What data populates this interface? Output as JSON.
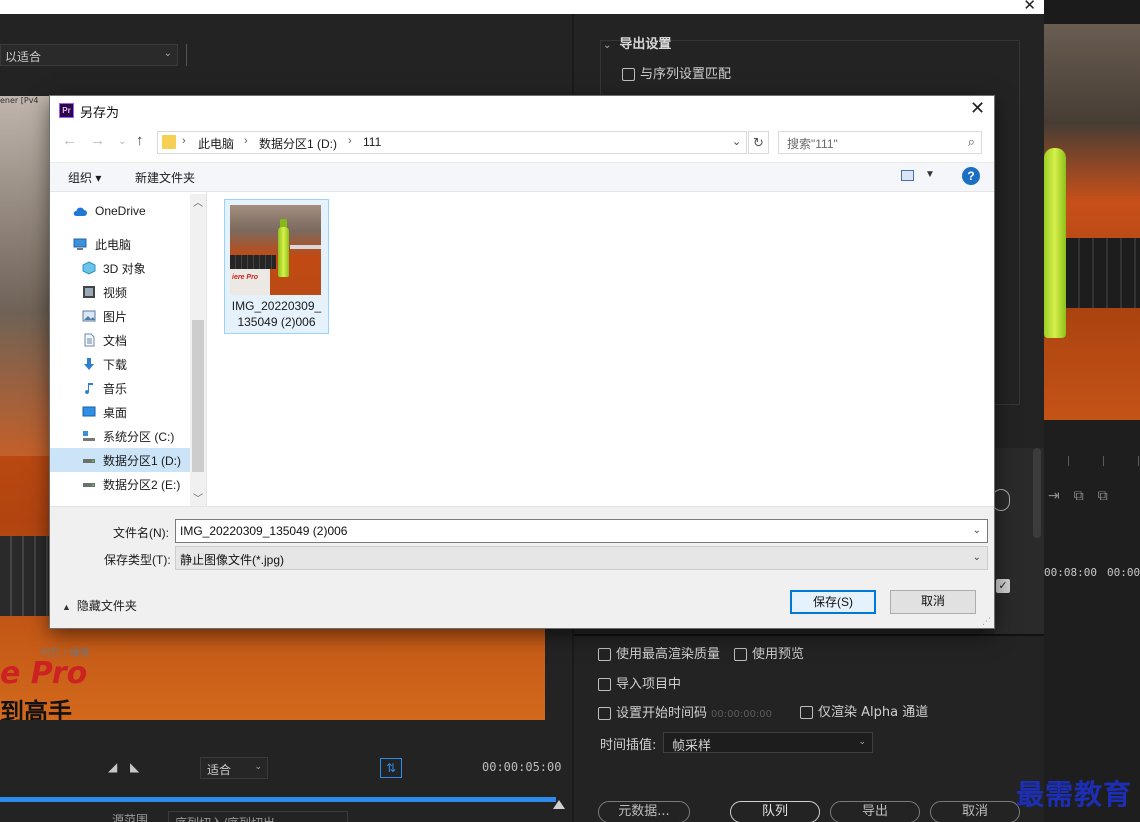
{
  "premiere": {
    "top_dropdown": "以适合",
    "preview_snippet": "ener [Pv4",
    "book_title": "e Pro",
    "book_author": "刘艺 / 编著",
    "book_subtitle": "到高手",
    "fit_dropdown": "适合",
    "timecode_left": "00:00:05:00",
    "source_range_label": "源范围",
    "source_range_value": "序列切入/序列切出",
    "export_settings_title": "导出设置",
    "match_sequence": "与序列设置匹配",
    "max_render_quality": "使用最高渲染质量",
    "use_previews": "使用预览",
    "import_into_project": "导入项目中",
    "set_start_timecode": "设置开始时间码",
    "start_timecode_value": "00:00:00:00",
    "render_alpha_only": "仅渲染 Alpha 通道",
    "time_interpolation_label": "时间插值:",
    "time_interpolation_value": "帧采样",
    "buttons": {
      "metadata": "元数据...",
      "queue": "队列",
      "export": "导出",
      "cancel": "取消"
    },
    "timecodes_right": [
      "00:08:00",
      "00:00"
    ],
    "watermark": "最需教育"
  },
  "dialog": {
    "title": "另存为",
    "app_icon_text": "Pr",
    "breadcrumb": [
      "此电脑",
      "数据分区1 (D:)",
      "111"
    ],
    "search_placeholder": "搜索\"111\"",
    "toolbar": {
      "organize": "组织 ▾",
      "new_folder": "新建文件夹"
    },
    "nav_tree": [
      {
        "label": "OneDrive",
        "icon": "cloud-icon"
      },
      {
        "label": "此电脑",
        "icon": "computer-icon"
      },
      {
        "label": "3D 对象",
        "icon": "cube-icon"
      },
      {
        "label": "视频",
        "icon": "video-icon"
      },
      {
        "label": "图片",
        "icon": "picture-icon"
      },
      {
        "label": "文档",
        "icon": "document-icon"
      },
      {
        "label": "下载",
        "icon": "download-icon"
      },
      {
        "label": "音乐",
        "icon": "music-icon"
      },
      {
        "label": "桌面",
        "icon": "desktop-icon"
      },
      {
        "label": "系统分区 (C:)",
        "icon": "system-drive-icon"
      },
      {
        "label": "数据分区1 (D:)",
        "icon": "drive-icon",
        "selected": true
      },
      {
        "label": "数据分区2 (E:)",
        "icon": "drive-icon"
      }
    ],
    "files": [
      {
        "name_line1": "IMG_20220309_",
        "name_line2": "135049 (2)006"
      }
    ],
    "thumb_text": "iere Pro",
    "filename_label": "文件名(N):",
    "filename_value": "IMG_20220309_135049 (2)006",
    "filetype_label": "保存类型(T):",
    "filetype_value": "静止图像文件(*.jpg)",
    "hide_folders": "隐藏文件夹",
    "save_button": "保存(S)",
    "cancel_button": "取消"
  },
  "colors": {
    "accent_blue": "#2d8ceb",
    "selection": "#cce4f7",
    "primary_border": "#0078d7",
    "watermark": "#1c2fb4"
  }
}
